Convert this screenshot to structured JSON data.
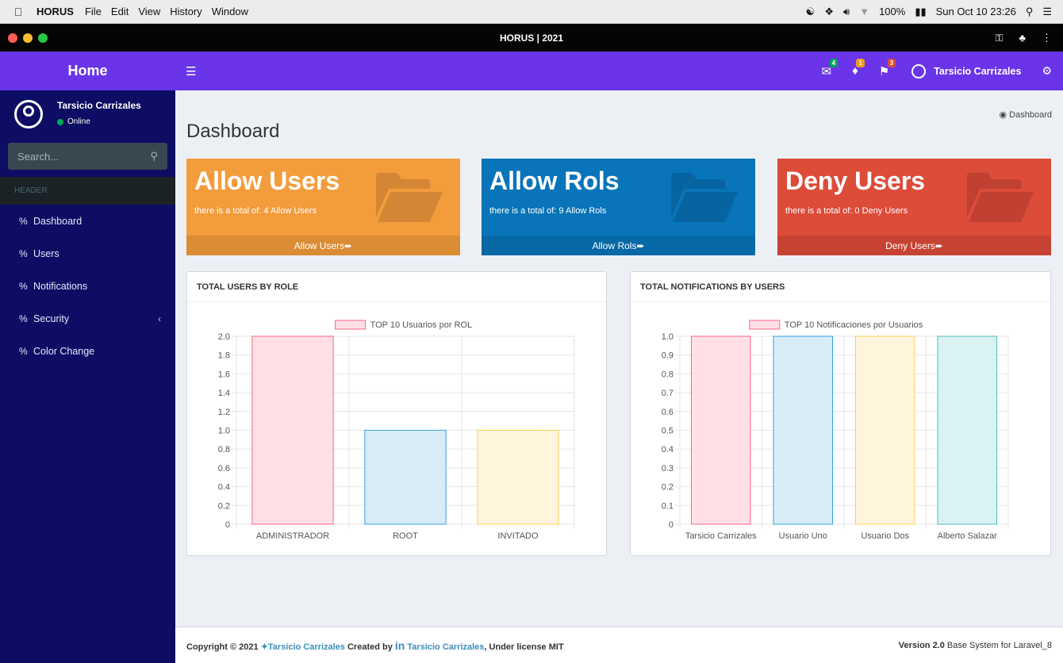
{
  "macbar": {
    "app": "HORUS",
    "menus": [
      "File",
      "Edit",
      "View",
      "History",
      "Window"
    ],
    "battery": "100%",
    "datetime": "Sun Oct 10  23:26"
  },
  "window": {
    "title": "HORUS | 2021"
  },
  "brand": "Home",
  "user": {
    "name": "Tarsicio Carrizales",
    "status": "Online"
  },
  "search": {
    "placeholder": "Search..."
  },
  "sidebar": {
    "header": "HEADER",
    "items": [
      {
        "label": "Dashboard"
      },
      {
        "label": "Users"
      },
      {
        "label": "Notifications"
      },
      {
        "label": "Security"
      },
      {
        "label": "Color Change"
      }
    ]
  },
  "navbar": {
    "mail_badge": "4",
    "bell_badge": "1",
    "flag_badge": "3",
    "user_name": "Tarsicio Carrizales"
  },
  "page": {
    "title": "Dashboard",
    "breadcrumb": "Dashboard"
  },
  "tiles": [
    {
      "title": "Allow Users",
      "subtitle": "there is a total of: 4  Allow Users",
      "footer": "Allow Users",
      "color": "#f39c3c"
    },
    {
      "title": "Allow Rols",
      "subtitle": "there is a total of: 9  Allow Rols",
      "footer": "Allow Rols",
      "color": "#0874b9"
    },
    {
      "title": "Deny Users",
      "subtitle": "there is a total of: 0  Deny Users",
      "footer": "Deny Users",
      "color": "#dd4b39"
    }
  ],
  "chart_data": [
    {
      "type": "bar",
      "panel_title": "TOTAL USERS BY ROLE",
      "legend": "TOP 10 Usuarios por ROL",
      "categories": [
        "ADMINISTRADOR",
        "ROOT",
        "INVITADO"
      ],
      "values": [
        2,
        1,
        1
      ],
      "yticks": [
        "2.0",
        "1.8",
        "1.6",
        "1.4",
        "1.2",
        "1.0",
        "0.8",
        "0.6",
        "0.4",
        "0.2",
        "0"
      ],
      "ylim": [
        0,
        2
      ],
      "fills": [
        "#ffe0e6",
        "#d8ecf7",
        "#fff5dd"
      ],
      "strokes": [
        "#ff6384",
        "#36a2eb",
        "#ffcd56"
      ]
    },
    {
      "type": "bar",
      "panel_title": "TOTAL NOTIFICATIONS BY USERS",
      "legend": "TOP 10 Notificaciones por Usuarios",
      "categories": [
        "Tarsicio Carrizales",
        "Usuario Uno",
        "Usuario Dos",
        "Alberto Salazar"
      ],
      "values": [
        1,
        1,
        1,
        1
      ],
      "yticks": [
        "1.0",
        "0.9",
        "0.8",
        "0.7",
        "0.6",
        "0.5",
        "0.4",
        "0.3",
        "0.2",
        "0.1",
        "0"
      ],
      "ylim": [
        0,
        1
      ],
      "fills": [
        "#ffe0e6",
        "#d8ecf7",
        "#fff5dd",
        "#dbf2f2"
      ],
      "strokes": [
        "#ff6384",
        "#36a2eb",
        "#ffcd56",
        "#4bc0c0"
      ]
    }
  ],
  "footer": {
    "copyright": "Copyright © 2021 ",
    "author1": "Tarsicio Carrizales",
    "created_by": " Created by ",
    "author2": "Tarsicio Carrizales",
    "license": ", Under license MIT",
    "version_label": "Version 2.0",
    "version_text": " Base System for Laravel_8"
  }
}
